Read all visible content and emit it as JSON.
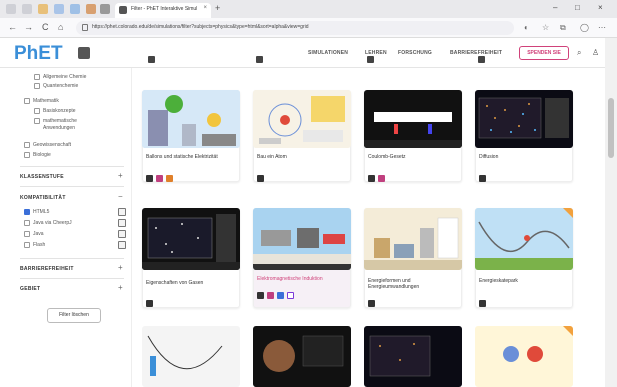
{
  "browser": {
    "tab_title": "Filter - PhET Interaktive Simulati",
    "tab_close": "×",
    "new_tab": "+",
    "url": "https://phet.colorado.edu/de/simulations/filter?subjects=physics&type=html&sort=alpha&view=grid",
    "back": "←",
    "forward": "→",
    "reload": "C",
    "home": "⌂",
    "win_min": "–",
    "win_max": "□",
    "win_close": "×"
  },
  "header": {
    "logo_p": "PhET",
    "nav": [
      "SIMULATIONEN",
      "LEHREN",
      "FORSCHUNG",
      "BARRIEREFREIHEIT"
    ],
    "donate": "SPENDEN SIE",
    "search_icon": "⌕",
    "account_icon": "♙"
  },
  "sidebar": {
    "chemistry_items": [
      "Allgemeine Chemie",
      "Quantenchemie"
    ],
    "math_label": "Mathematik",
    "math_items": [
      "Basiskonzepte",
      "mathematische",
      "Anwendungen"
    ],
    "other_subjects": [
      "Geowissenschaft",
      "Biologie"
    ],
    "section_grade": "KLASSENSTUFE",
    "section_compat": "KOMPATIBILITÄT",
    "compat_items": [
      {
        "label": "HTML5",
        "checked": true
      },
      {
        "label": "Java via CheerpJ",
        "checked": false
      },
      {
        "label": "Java",
        "checked": false
      },
      {
        "label": "Flash",
        "checked": false
      }
    ],
    "section_access": "BARRIEREFREIHEIT",
    "section_area": "GEBIET",
    "plus": "+",
    "minus": "−",
    "filter_clear": "Filter löschen"
  },
  "cards": [
    {
      "title": "Ballons und statische Elektrizität",
      "badges": [
        "#333",
        "#c0407f",
        "#e0802a"
      ]
    },
    {
      "title": "Bau ein Atom",
      "badges": [
        "#333"
      ]
    },
    {
      "title": "Coulomb-Gesetz",
      "badges": [
        "#333",
        "#c0407f"
      ]
    },
    {
      "title": "Diffusion",
      "badges": [
        "#333"
      ]
    },
    {
      "title": "Eigenschaften von Gasen",
      "badges": [
        "#333"
      ]
    },
    {
      "title": "Elektromagnetische Induktion",
      "badges": [
        "#333",
        "#c0407f",
        "#3b6fd8",
        "#7c3bd8"
      ],
      "highlight": true
    },
    {
      "title": "Energieformen und Energieumwandlungen",
      "badges": [
        "#333"
      ]
    },
    {
      "title": "Energieskatepark",
      "badges": [
        "#333"
      ]
    }
  ],
  "colors": {
    "brand_blue": "#3b8fd8",
    "donate_pink": "#d0427a",
    "checkbox_blue": "#3b6fd8"
  }
}
